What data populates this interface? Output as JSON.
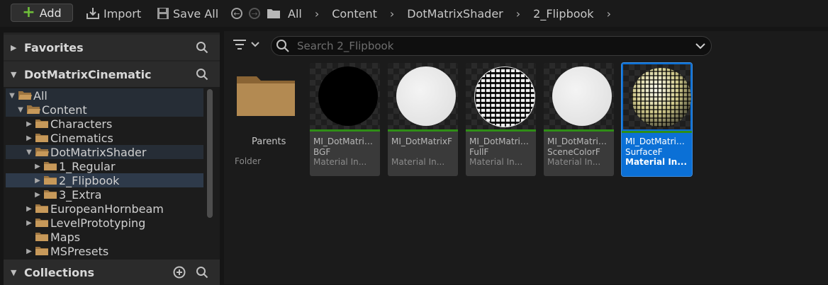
{
  "toolbar": {
    "add_label": "Add",
    "import_label": "Import",
    "save_all_label": "Save All"
  },
  "breadcrumb": [
    "All",
    "Content",
    "DotMatrixShader",
    "2_Flipbook"
  ],
  "left_panel": {
    "favorites_label": "Favorites",
    "project_label": "DotMatrixCinematic",
    "collections_label": "Collections",
    "tree": [
      {
        "label": "All",
        "depth": 0,
        "expanded": true
      },
      {
        "label": "Content",
        "depth": 1,
        "expanded": true
      },
      {
        "label": "Characters",
        "depth": 2,
        "expanded": false
      },
      {
        "label": "Cinematics",
        "depth": 2,
        "expanded": false
      },
      {
        "label": "DotMatrixShader",
        "depth": 2,
        "expanded": true
      },
      {
        "label": "1_Regular",
        "depth": 3,
        "expanded": false
      },
      {
        "label": "2_Flipbook",
        "depth": 3,
        "expanded": false,
        "selected": true
      },
      {
        "label": "3_Extra",
        "depth": 3,
        "expanded": false
      },
      {
        "label": "EuropeanHornbeam",
        "depth": 2,
        "expanded": false
      },
      {
        "label": "LevelPrototyping",
        "depth": 2,
        "expanded": false
      },
      {
        "label": "Maps",
        "depth": 2,
        "expanded": false
      },
      {
        "label": "MSPresets",
        "depth": 2,
        "expanded": false
      }
    ]
  },
  "search": {
    "placeholder": "Search 2_Flipbook"
  },
  "folder_tile": {
    "name": "Parents",
    "type": "Folder"
  },
  "assets": [
    {
      "line1": "MI_DotMatrix...",
      "line2": "BGF",
      "type": "Material In...",
      "thumb": "black"
    },
    {
      "line1": "MI_DotMatrixF",
      "line2": "",
      "type": "Material In...",
      "thumb": "white"
    },
    {
      "line1": "MI_DotMatrix...",
      "line2": "FullF",
      "type": "Material In...",
      "thumb": "grid"
    },
    {
      "line1": "MI_DotMatrix...",
      "line2": "SceneColorF",
      "type": "Material In...",
      "thumb": "white"
    },
    {
      "line1": "MI_DotMatrix...",
      "line2": "SurfaceF",
      "type": "Material In...",
      "thumb": "surface",
      "selected": true
    }
  ],
  "colors": {
    "accent_green": "#6fbf3a",
    "selection_blue": "#0b70d6",
    "asset_bar_green": "#2f8e16"
  }
}
